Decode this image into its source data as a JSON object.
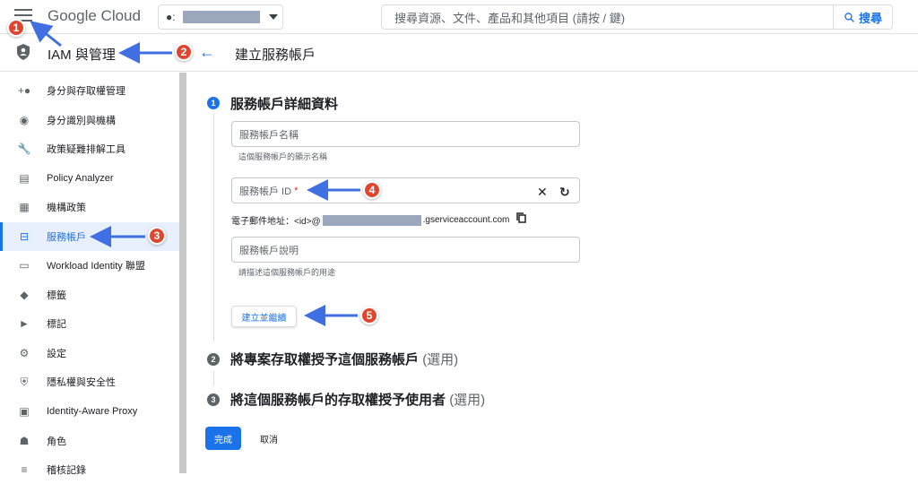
{
  "topbar": {
    "logo_text": "Google Cloud",
    "search_placeholder": "搜尋資源、文件、產品和其他項目 (請按 / 鍵)",
    "search_button": "搜尋"
  },
  "subbar": {
    "section_title": "IAM 與管理",
    "page_title": "建立服務帳戶"
  },
  "sidebar": {
    "items": [
      {
        "label": "身分與存取權管理",
        "icon": "person-add-icon"
      },
      {
        "label": "身分識別與機構",
        "icon": "account-circle-icon"
      },
      {
        "label": "政策疑難排解工具",
        "icon": "wrench-icon"
      },
      {
        "label": "Policy Analyzer",
        "icon": "document-search-icon"
      },
      {
        "label": "機構政策",
        "icon": "list-icon"
      },
      {
        "label": "服務帳戶",
        "icon": "service-account-icon",
        "active": true
      },
      {
        "label": "Workload Identity 聯盟",
        "icon": "id-card-icon"
      },
      {
        "label": "標籤",
        "icon": "tag-icon"
      },
      {
        "label": "標記",
        "icon": "label-icon"
      },
      {
        "label": "設定",
        "icon": "gear-icon"
      },
      {
        "label": "隱私權與安全性",
        "icon": "shield-icon"
      },
      {
        "label": "Identity-Aware Proxy",
        "icon": "proxy-icon"
      },
      {
        "label": "角色",
        "icon": "roles-icon"
      },
      {
        "label": "稽核記錄",
        "icon": "audit-log-icon"
      }
    ]
  },
  "steps": {
    "step1": {
      "num": "1",
      "title": "服務帳戶詳細資料"
    },
    "step2": {
      "num": "2",
      "title": "將專案存取權授予這個服務帳戶",
      "optional": "(選用)"
    },
    "step3": {
      "num": "3",
      "title": "將這個服務帳戶的存取權授予使用者",
      "optional": "(選用)"
    }
  },
  "form": {
    "name_placeholder": "服務帳戶名稱",
    "name_hint": "這個服務帳戶的顯示名稱",
    "id_placeholder": "服務帳戶 ID",
    "id_required": "*",
    "email_prefix": "電子郵件地址：<id>@",
    "email_suffix": ".gserviceaccount.com",
    "desc_placeholder": "服務帳戶說明",
    "desc_hint": "請描述這個服務帳戶的用途",
    "create_continue": "建立並繼續"
  },
  "actions": {
    "done": "完成",
    "cancel": "取消"
  },
  "callouts": [
    "1",
    "2",
    "3",
    "4",
    "5"
  ],
  "colors": {
    "accent": "#1a73e8",
    "callout": "#e0462f",
    "arrow": "#3f6fe0"
  }
}
